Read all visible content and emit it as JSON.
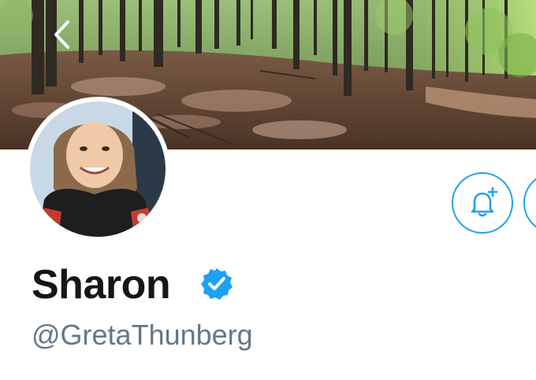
{
  "profile": {
    "display_name": "Sharon",
    "handle": "@GretaThunberg",
    "verified": true
  },
  "header": {
    "back_icon": "chevron-left-icon"
  },
  "actions": {
    "notify_icon": "bell-plus-icon"
  },
  "colors": {
    "accent": "#1da1f2",
    "name": "#14171a",
    "handle": "#657786"
  }
}
